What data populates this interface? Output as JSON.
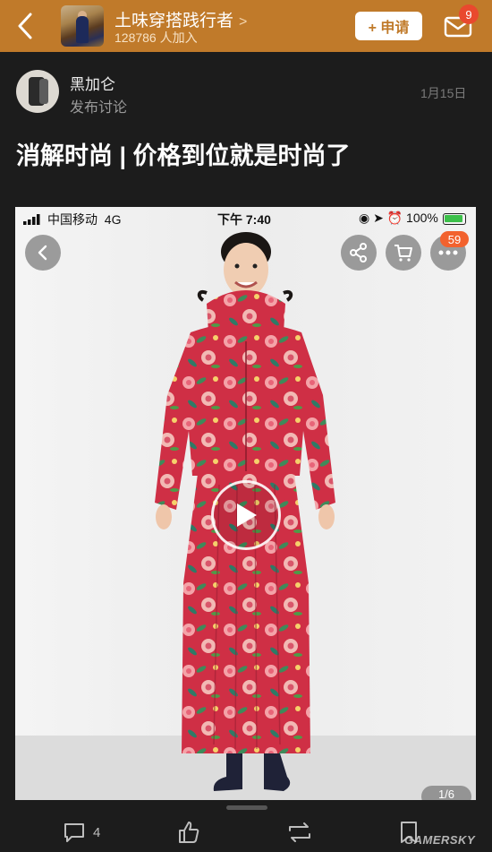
{
  "header": {
    "back_icon": "chevron-left-icon",
    "group_name": "土味穿搭践行者",
    "group_members": "128786 人加入",
    "apply_label": "+ 申请",
    "mail_icon": "mail-icon",
    "mail_badge": "9",
    "accent": "#c07a2a"
  },
  "post": {
    "author_name": "黑加仑",
    "author_sub": "发布讨论",
    "date": "1月15日",
    "title": "消解时尚 | 价格到位就是时尚了"
  },
  "embedded_screenshot": {
    "carrier": "中国移动",
    "network": "4G",
    "time": "下午 7:40",
    "battery": "100%",
    "like_badge": "59",
    "page_indicator": "1/6",
    "icons": [
      "back-icon",
      "share-icon",
      "cart-icon",
      "more-icon",
      "play-icon"
    ]
  },
  "bottom_bar": {
    "comment_count": "4",
    "icons": [
      "comment-icon",
      "like-icon",
      "repost-icon",
      "bookmark-icon"
    ]
  },
  "watermark": "GAMERSKY"
}
